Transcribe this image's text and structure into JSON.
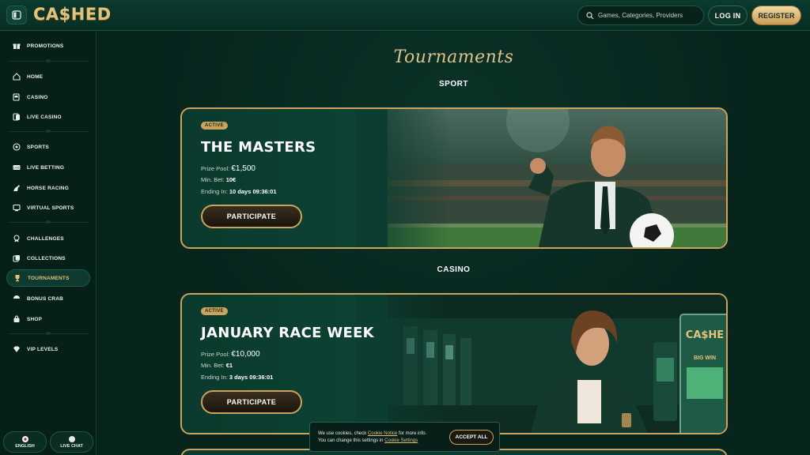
{
  "header": {
    "logo": "CA$HED",
    "search_placeholder": "Games, Categories, Providers",
    "login_label": "LOG IN",
    "register_label": "REGISTER"
  },
  "sidebar": {
    "items": [
      {
        "label": "PROMOTIONS",
        "icon": "gift-icon"
      },
      {
        "label": "HOME",
        "icon": "home-icon"
      },
      {
        "label": "CASINO",
        "icon": "slot-icon"
      },
      {
        "label": "LIVE CASINO",
        "icon": "cards-icon"
      },
      {
        "label": "SPORTS",
        "icon": "ball-icon"
      },
      {
        "label": "LIVE BETTING",
        "icon": "live-icon"
      },
      {
        "label": "HORSE RACING",
        "icon": "horse-icon"
      },
      {
        "label": "VIRTUAL SPORTS",
        "icon": "virtual-icon"
      },
      {
        "label": "CHALLENGES",
        "icon": "medal-icon"
      },
      {
        "label": "COLLECTIONS",
        "icon": "collection-icon"
      },
      {
        "label": "TOURNAMENTS",
        "icon": "trophy-icon",
        "active": true
      },
      {
        "label": "BONUS CRAB",
        "icon": "crab-icon"
      },
      {
        "label": "SHOP",
        "icon": "bag-icon"
      },
      {
        "label": "VIP LEVELS",
        "icon": "diamond-icon"
      }
    ],
    "language_label": "ENGLISH",
    "live_chat_label": "LIVE CHAT"
  },
  "main": {
    "title": "Tournaments",
    "sections": [
      {
        "label": "SPORT",
        "card": {
          "badge": "ACTIVE",
          "title": "THE MASTERS",
          "prize_label": "Prize Pool:",
          "prize_value": "€1,500",
          "minbet_label": "Min. Bet:",
          "minbet_value": "10€",
          "ending_label": "Ending In:",
          "ending_value": "10 days 09:36:01",
          "button": "PARTICIPATE"
        }
      },
      {
        "label": "CASINO",
        "card": {
          "badge": "ACTIVE",
          "title": "JANUARY RACE WEEK",
          "prize_label": "Prize Pool:",
          "prize_value": "€10,000",
          "minbet_label": "Min. Bet:",
          "minbet_value": "€1",
          "ending_label": "Ending In:",
          "ending_value": "3 days 09:36:01",
          "button": "PARTICIPATE",
          "machine_label": "CA$HE",
          "machine_sub": "BIG WIN"
        }
      }
    ]
  },
  "cookie": {
    "line1_pre": "We use cookies, check ",
    "line1_link": "Cookie Notice",
    "line1_post": " for more info.",
    "line2_pre": "You can change this settings in ",
    "line2_link": "Cookie Settings",
    "accept": "ACCEPT ALL"
  },
  "colors": {
    "accent_gold": "#c9a45a",
    "background": "#07241d",
    "panel": "#0b3a2e"
  }
}
